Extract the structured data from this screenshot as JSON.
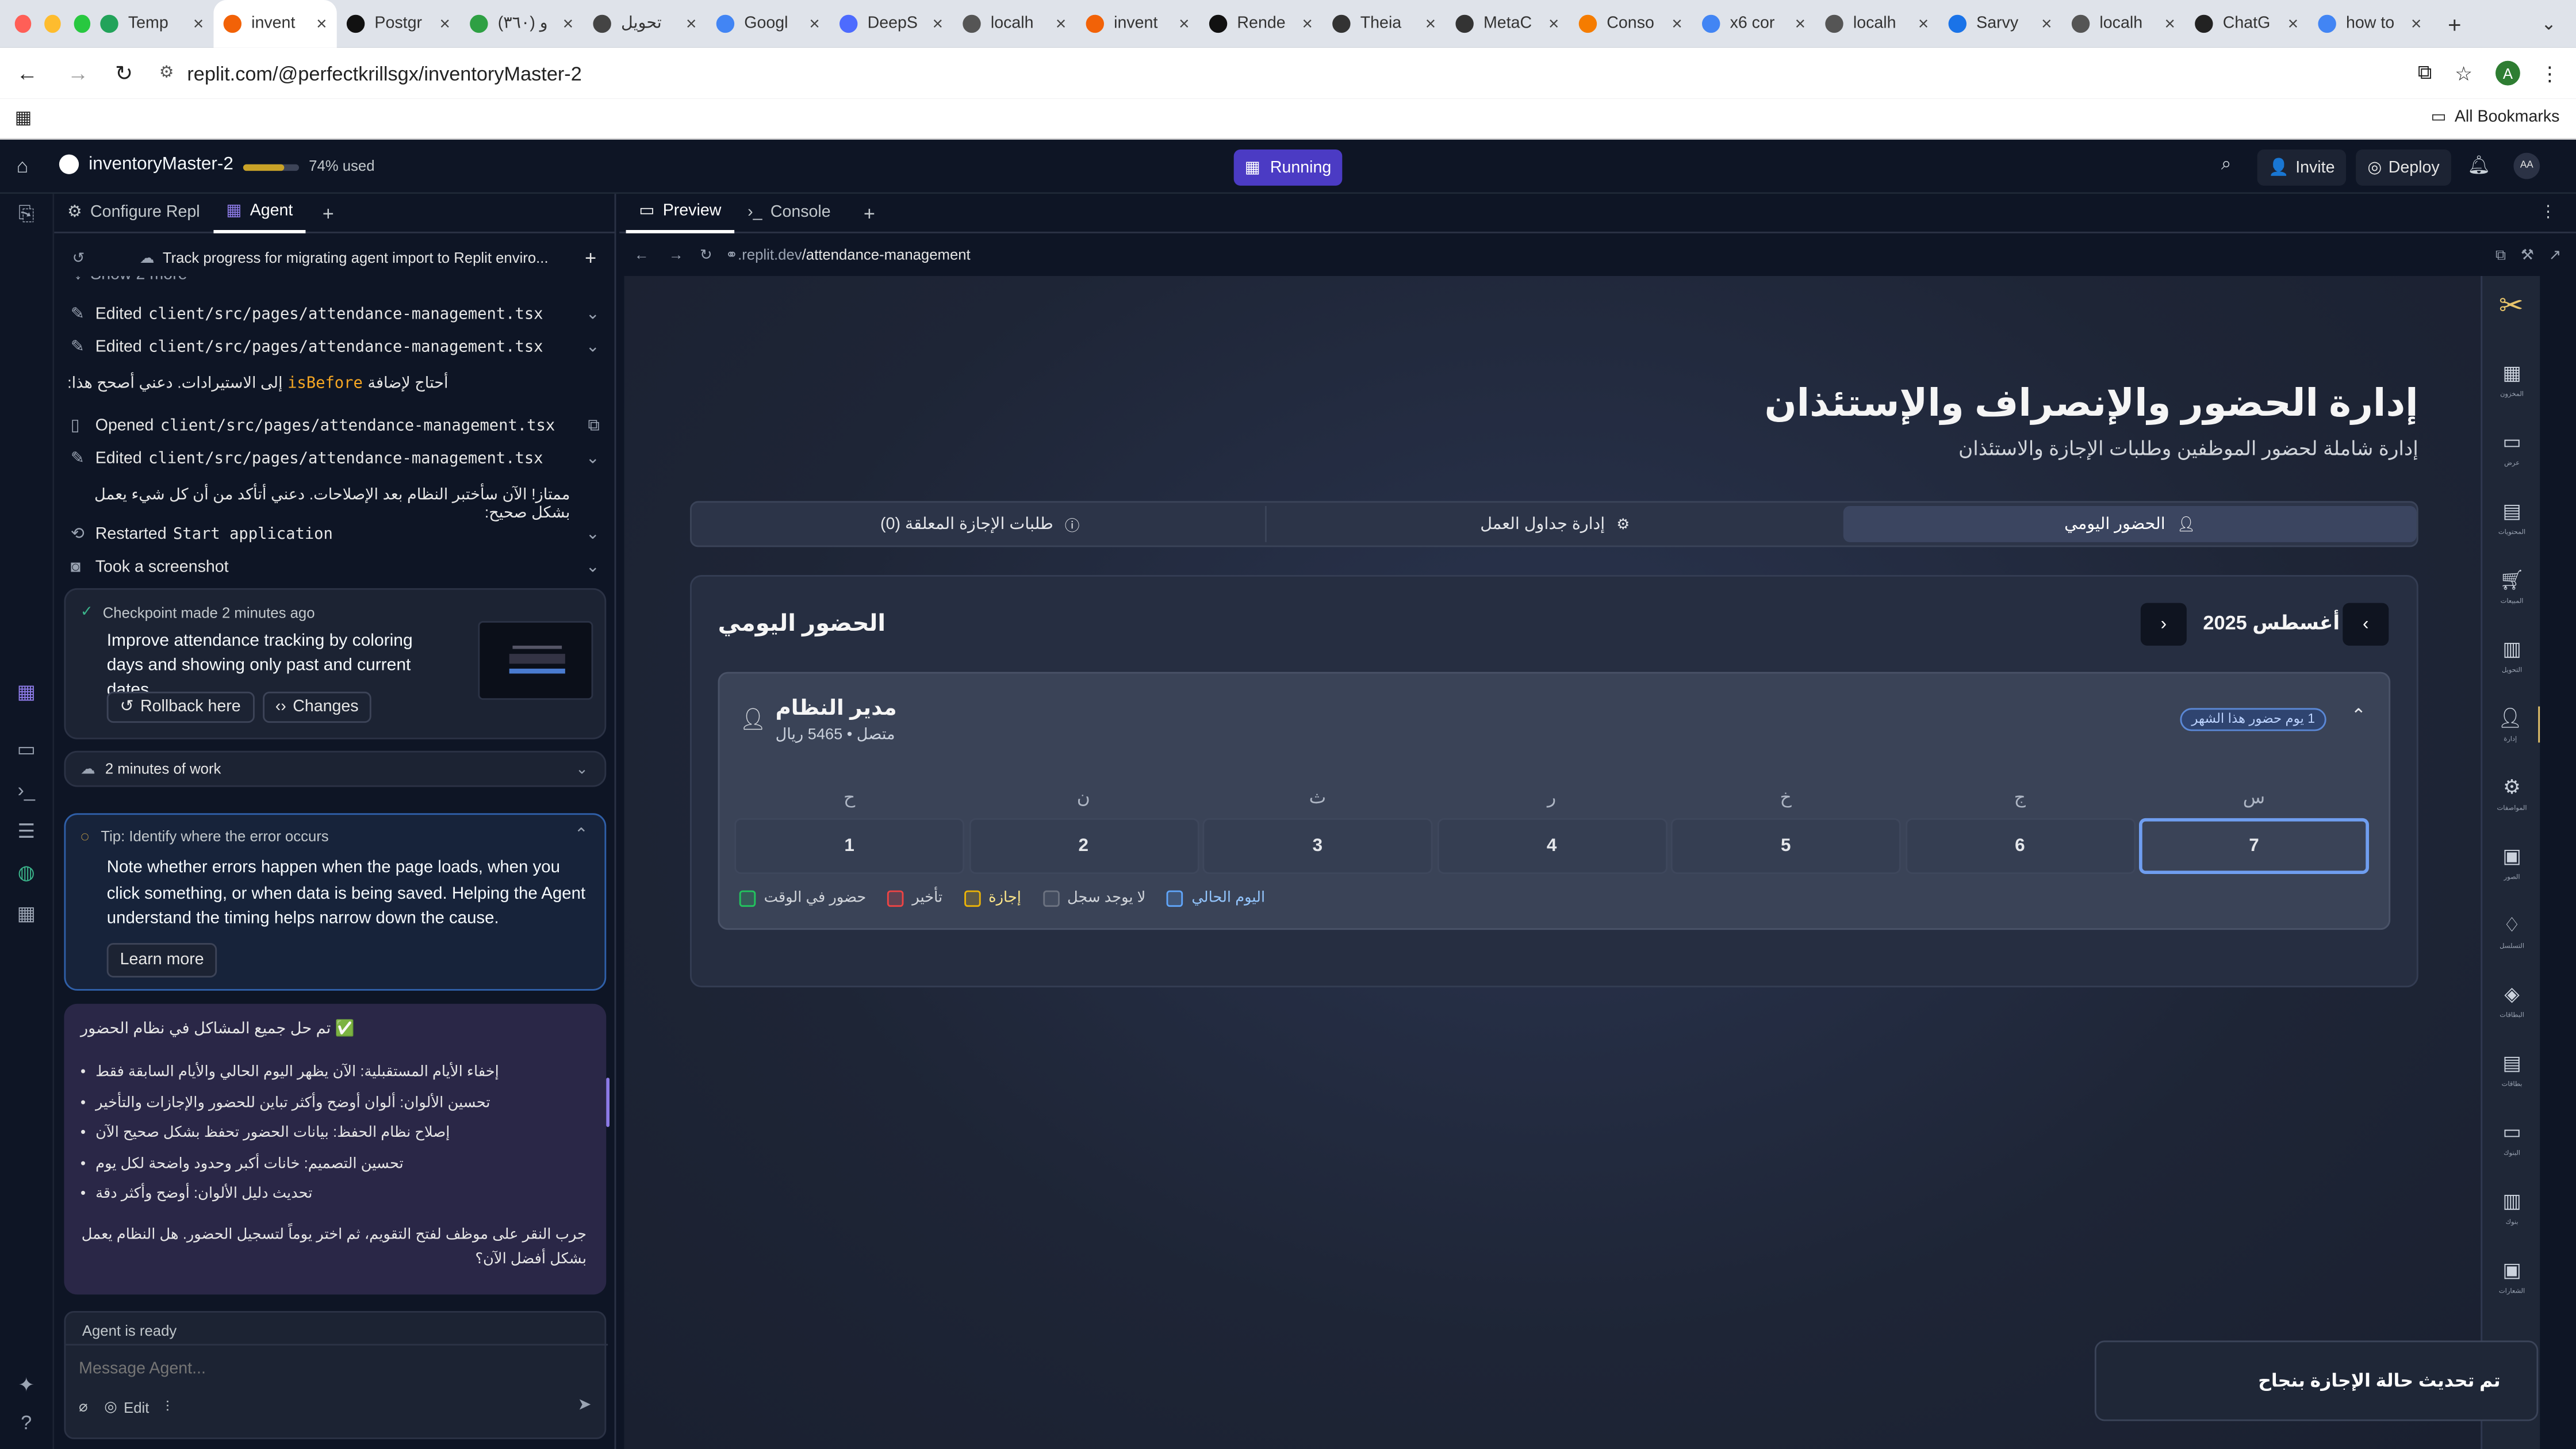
{
  "browser": {
    "tabs": [
      {
        "label": "Temp",
        "color": "#22a35a",
        "active": false
      },
      {
        "label": "invent",
        "color": "#f26207",
        "active": true
      },
      {
        "label": "Postgr",
        "color": "#111111",
        "active": false
      },
      {
        "label": "(٣٦٠) و",
        "color": "#2ea043",
        "active": false
      },
      {
        "label": "تحويل",
        "color": "#444444",
        "active": false
      },
      {
        "label": "Googl",
        "color": "#4285f4",
        "active": false
      },
      {
        "label": "DeepS",
        "color": "#4d6bfe",
        "active": false
      },
      {
        "label": "localh",
        "color": "#555555",
        "active": false
      },
      {
        "label": "invent",
        "color": "#f26207",
        "active": false
      },
      {
        "label": "Rende",
        "color": "#111111",
        "active": false
      },
      {
        "label": "Theia",
        "color": "#333333",
        "active": false
      },
      {
        "label": "MetaC",
        "color": "#333333",
        "active": false
      },
      {
        "label": "Conso",
        "color": "#f57c00",
        "active": false
      },
      {
        "label": "x6 cor",
        "color": "#4285f4",
        "active": false
      },
      {
        "label": "localh",
        "color": "#555555",
        "active": false
      },
      {
        "label": "Sarvy",
        "color": "#1a73e8",
        "active": false
      },
      {
        "label": "localh",
        "color": "#555555",
        "active": false
      },
      {
        "label": "ChatG",
        "color": "#222222",
        "active": false
      },
      {
        "label": "how to",
        "color": "#4285f4",
        "active": false
      }
    ],
    "url": "replit.com/@perfectkrillsgx/inventoryMaster-2",
    "all_bookmarks": "All Bookmarks",
    "profile_initial": "A"
  },
  "topbar": {
    "project_name": "inventoryMaster-2",
    "usage": "74% used",
    "usage_fraction": 0.74,
    "run_status": "Running",
    "invite": "Invite",
    "deploy": "Deploy",
    "avatar": "AA"
  },
  "left_tabs": {
    "configure": "Configure Repl",
    "agent": "Agent"
  },
  "agent": {
    "thread_title": "Track progress for migrating agent import to Replit enviro...",
    "show_more": "Show 2 more",
    "edit1_prefix": "Edited",
    "edit1_file": "client/src/pages/attendance-management.tsx",
    "edit2_prefix": "Edited",
    "edit2_file": "client/src/pages/attendance-management.tsx",
    "msg1_pre": "أحتاج لإضافة",
    "msg1_code": "isBefore",
    "msg1_post": "إلى الاستيرادات. دعني أصحح هذا:",
    "opened_prefix": "Opened",
    "opened_file": "client/src/pages/attendance-management.tsx",
    "edit3_prefix": "Edited",
    "edit3_file": "client/src/pages/attendance-management.tsx",
    "msg2": "ممتاز! الآن سأختبر النظام بعد الإصلاحات. دعني أتأكد من أن كل شيء يعمل بشكل صحيح:",
    "restarted_prefix": "Restarted",
    "restarted_name": "Start application",
    "screenshot": "Took a screenshot",
    "checkpoint": {
      "title": "Checkpoint made 2 minutes ago",
      "body": "Improve attendance tracking by coloring days and showing only past and current dates",
      "rollback": "Rollback here",
      "changes": "Changes"
    },
    "work_time": "2 minutes of work",
    "tip": {
      "title": "Tip: Identify where the error occurs",
      "body": "Note whether errors happen when the page loads, when you click something, or when data is being saved. Helping the Agent understand the timing helps narrow down the cause.",
      "learn_more": "Learn more"
    },
    "summary": {
      "heading": "✅ تم حل جميع المشاكل في نظام الحضور",
      "items": [
        "إخفاء الأيام المستقبلية: الآن يظهر اليوم الحالي والأيام السابقة فقط",
        "تحسين الألوان: ألوان أوضح وأكثر تباين للحضور والإجازات والتأخير",
        "إصلاح نظام الحفظ: بيانات الحضور تحفظ بشكل صحيح الآن",
        "تحسين التصميم: خانات أكبر وحدود واضحة لكل يوم",
        "تحديث دليل الألوان: أوضح وأكثر دقة"
      ],
      "footer": "جرب النقر على موظف لفتح التقويم، ثم اختر يوماً لتسجيل الحضور. هل النظام يعمل بشكل أفضل الآن؟"
    },
    "status": "Agent is ready",
    "input_placeholder": "Message Agent...",
    "edit_label": "Edit"
  },
  "preview": {
    "tab_preview": "Preview",
    "tab_console": "Console",
    "url_domain": ".replit.dev",
    "url_path": "/attendance-management"
  },
  "app": {
    "title": "إدارة الحضور والإنصراف والإستئذان",
    "subtitle": "إدارة شاملة لحضور الموظفين وطلبات الإجازة والاستئذان",
    "tabs": {
      "daily": "الحضور اليومي",
      "schedules": "إدارة جداول العمل",
      "pending": "طلبات الإجازة المعلقة (0)"
    },
    "section_title": "الحضور اليومي",
    "month": "أغسطس 2025",
    "employee": {
      "name": "مدير النظام",
      "meta": "متصل • 5465 ريال",
      "badge": "1 يوم حضور هذا الشهر"
    },
    "day_headers": [
      "س",
      "ج",
      "خ",
      "ر",
      "ث",
      "ن",
      "ح"
    ],
    "days": [
      "7",
      "6",
      "5",
      "4",
      "3",
      "2",
      "1"
    ],
    "legend": [
      {
        "label": "حضور في الوقت",
        "color": "#22c55e"
      },
      {
        "label": "تأخير",
        "color": "#ef4444"
      },
      {
        "label": "إجازة",
        "color": "#eab308"
      },
      {
        "label": "لا يوجد سجل",
        "color": "#6b7280"
      },
      {
        "label": "اليوم الحالي",
        "color": "#60a5fa"
      }
    ],
    "toast": "تم تحديث حالة الإجازة بنجاح",
    "sidebar_labels": [
      "المخزون",
      "عرض",
      "المحتويات",
      "المبيعات",
      "التحويل",
      "إدارة",
      "المواصفات",
      "الصور",
      "التسلسل",
      "البطاقات",
      "بطاقات",
      "البنوك",
      "بنوك",
      "الشعارات"
    ]
  }
}
